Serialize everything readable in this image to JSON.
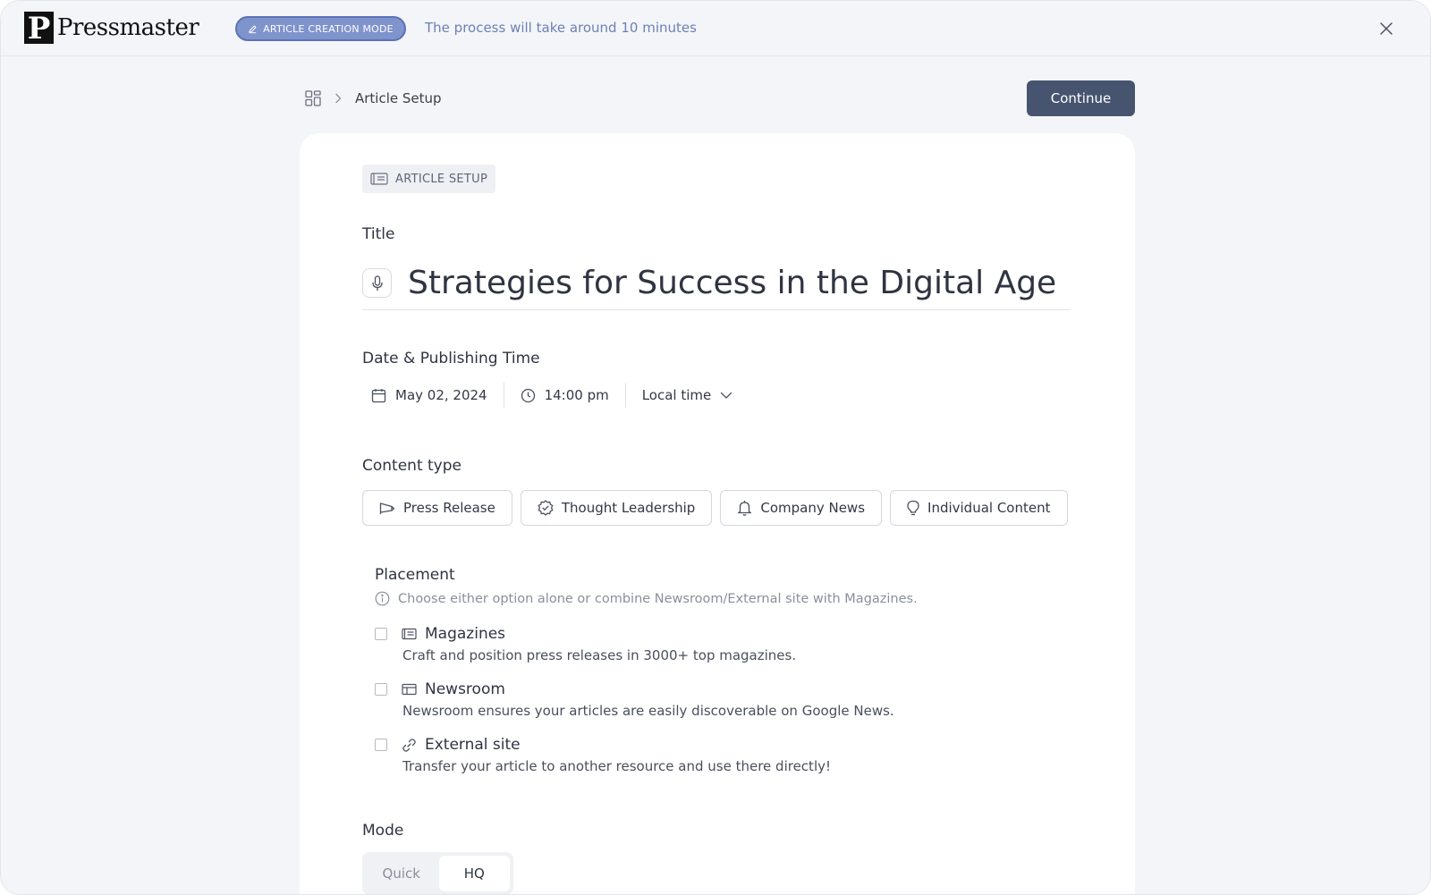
{
  "app": {
    "logo_letter": "P",
    "logo_text": "Pressmaster"
  },
  "topbar": {
    "mode_badge": "ARTICLE CREATION MODE",
    "note": "The process will take around 10 minutes"
  },
  "breadcrumb": {
    "current": "Article Setup"
  },
  "actions": {
    "continue_label": "Continue"
  },
  "card": {
    "section_tag": "ARTICLE SETUP",
    "title_label": "Title",
    "title_value": "Strategies for Success in the Digital Age",
    "date_label": "Date & Publishing Time",
    "date": "May 02, 2024",
    "time": "14:00 pm",
    "timezone": "Local time",
    "content_type_label": "Content type",
    "content_types": [
      {
        "label": "Press Release",
        "icon": "megaphone-icon"
      },
      {
        "label": "Thought Leadership",
        "icon": "badge-check-icon"
      },
      {
        "label": "Company News",
        "icon": "bell-icon"
      },
      {
        "label": "Individual Content",
        "icon": "lightbulb-icon"
      }
    ],
    "placement_label": "Placement",
    "placement_hint": "Choose either option alone or combine Newsroom/External site with Magazines.",
    "placements": [
      {
        "name": "Magazines",
        "desc": "Craft and position press releases in 3000+ top magazines.",
        "icon": "newspaper-icon",
        "checked": false
      },
      {
        "name": "Newsroom",
        "desc": "Newsroom ensures your articles are easily discoverable on Google News.",
        "icon": "layout-icon",
        "checked": false
      },
      {
        "name": "External site",
        "desc": "Transfer your article to another resource and use there directly!",
        "icon": "link-icon",
        "checked": false
      }
    ],
    "mode_label": "Mode",
    "mode_options": [
      "Quick",
      "HQ"
    ],
    "mode_selected": "HQ"
  },
  "colors": {
    "accent": "#465470",
    "badge_bg": "#7f93cc",
    "page_bg": "#f4f5f8"
  }
}
